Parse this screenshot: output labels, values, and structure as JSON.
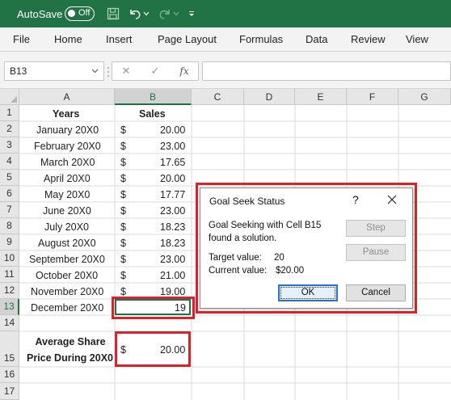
{
  "titlebar": {
    "autosave_label": "AutoSave",
    "toggle_state": "Off",
    "bg_color": "#217346",
    "icons": [
      "save-icon",
      "undo-icon",
      "undo-dropdown-icon",
      "redo-icon",
      "redo-dropdown-icon",
      "customize-qat-icon"
    ]
  },
  "ribbon": {
    "tabs": [
      "File",
      "Home",
      "Insert",
      "Page Layout",
      "Formulas",
      "Data",
      "Review",
      "View"
    ]
  },
  "formula_bar": {
    "name_box": "B13",
    "cancel_glyph": "✕",
    "enter_glyph": "✓",
    "fx_glyph": "fx",
    "formula": ""
  },
  "sheet": {
    "columns": [
      "A",
      "B",
      "C",
      "D",
      "E",
      "F",
      "G"
    ],
    "selected_column": "B",
    "rows": [
      "1",
      "2",
      "3",
      "4",
      "5",
      "6",
      "7",
      "8",
      "9",
      "10",
      "11",
      "12",
      "13",
      "14",
      "15",
      "16",
      "17"
    ],
    "selected_row": "13",
    "header": {
      "years": "Years",
      "sales": "Sales"
    },
    "data": [
      {
        "year": "January 20X0",
        "currency": "$",
        "sales": "20.00"
      },
      {
        "year": "February 20X0",
        "currency": "$",
        "sales": "23.00"
      },
      {
        "year": "March 20X0",
        "currency": "$",
        "sales": "17.65"
      },
      {
        "year": "April 20X0",
        "currency": "$",
        "sales": "20.00"
      },
      {
        "year": "May 20X0",
        "currency": "$",
        "sales": "17.77"
      },
      {
        "year": "June 20X0",
        "currency": "$",
        "sales": "23.00"
      },
      {
        "year": "July 20X0",
        "currency": "$",
        "sales": "18.23"
      },
      {
        "year": "August 20X0",
        "currency": "$",
        "sales": "18.23"
      },
      {
        "year": "September 20X0",
        "currency": "$",
        "sales": "23.00"
      },
      {
        "year": "October 20X0",
        "currency": "$",
        "sales": "21.00"
      },
      {
        "year": "November 20X0",
        "currency": "$",
        "sales": "19.00"
      },
      {
        "year": "December 20X0",
        "currency": "",
        "sales": "19"
      }
    ],
    "average_label_line1": "Average Share",
    "average_label_line2": "Price During 20X0",
    "average_currency": "$",
    "average_value": "20.00",
    "highlight_color": "#d9232b"
  },
  "dialog": {
    "title": "Goal Seek Status",
    "help_glyph": "?",
    "message_line1": "Goal Seeking with Cell B15",
    "message_line2": "found a solution.",
    "target_label": "Target value:",
    "target_value": "20",
    "current_label": "Current value:",
    "current_value": "$20.00",
    "step_label": "Step",
    "pause_label": "Pause",
    "ok_label": "OK",
    "cancel_label": "Cancel"
  }
}
